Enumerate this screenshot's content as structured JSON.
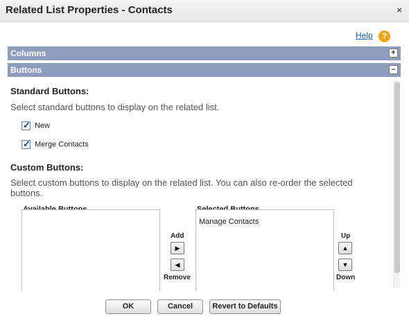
{
  "window": {
    "title": "Related List Properties - Contacts",
    "close_glyph": "×"
  },
  "help": {
    "label": "Help",
    "icon_glyph": "?"
  },
  "sections": {
    "columns": {
      "label": "Columns",
      "toggle_glyph": "+"
    },
    "buttons": {
      "label": "Buttons",
      "toggle_glyph": "–"
    }
  },
  "standard_buttons": {
    "heading": "Standard Buttons:",
    "description": "Select standard buttons to display on the related list.",
    "options": [
      {
        "label": "New",
        "checked": true
      },
      {
        "label": "Merge Contacts",
        "checked": true
      }
    ]
  },
  "custom_buttons": {
    "heading": "Custom Buttons:",
    "description": "Select custom buttons to display on the related list. You can also re-order the selected buttons.",
    "available_title": "Available Buttons",
    "selected_title": "Selected Buttons",
    "available_items": [],
    "selected_items": [
      "Manage Contacts"
    ],
    "add_label": "Add",
    "remove_label": "Remove",
    "up_label": "Up",
    "down_label": "Down",
    "add_glyph": "▶",
    "remove_glyph": "◀",
    "up_glyph": "▲",
    "down_glyph": "▼"
  },
  "footer": {
    "ok_label": "OK",
    "cancel_label": "Cancel",
    "revert_label": "Revert to Defaults"
  }
}
